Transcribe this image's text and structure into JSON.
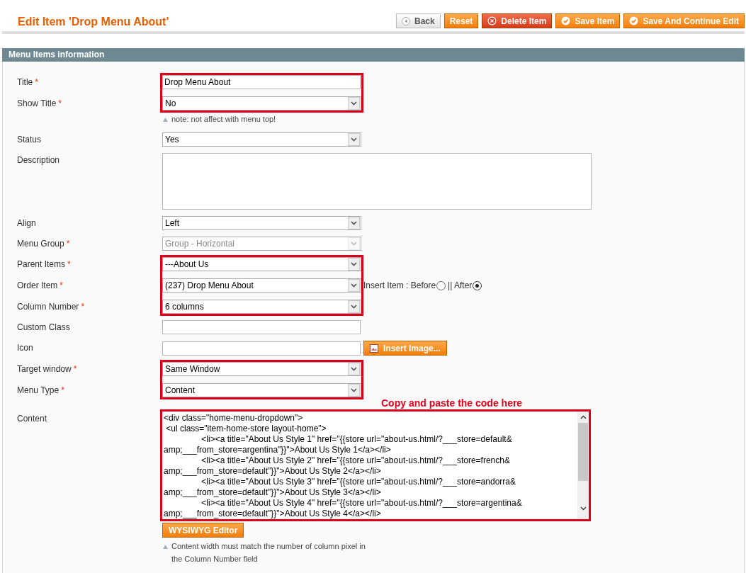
{
  "page_title": "Edit Item 'Drop Menu About'",
  "buttons": [
    {
      "label": "Back",
      "kind": "back"
    },
    {
      "label": "Reset",
      "kind": "plain"
    },
    {
      "label": "Delete Item",
      "kind": "delete"
    },
    {
      "label": "Save Item",
      "kind": "save"
    },
    {
      "label": "Save And Continue Edit",
      "kind": "save"
    }
  ],
  "section_title": "Menu Items information",
  "groups": [
    {
      "highlighted": true,
      "fields": [
        {
          "label": "Title",
          "mark": "*",
          "kind": "text",
          "value": "Drop Menu About"
        },
        {
          "label": "Show Title",
          "mark": "*",
          "kind": "select",
          "value": "No",
          "disabled": false
        }
      ],
      "note": "note: not affect with menu top!"
    },
    {
      "highlighted": false,
      "fields": [
        {
          "label": "Status",
          "kind": "select",
          "value": "Yes",
          "disabled": false
        }
      ]
    },
    {
      "highlighted": false,
      "fields": [
        {
          "label": "Description",
          "kind": "textarea"
        }
      ]
    },
    {
      "highlighted": false,
      "fields": [
        {
          "label": "Align",
          "kind": "select",
          "value": "Left",
          "disabled": false
        }
      ]
    },
    {
      "highlighted": false,
      "fields": [
        {
          "label": "Menu Group",
          "mark": "*",
          "kind": "select",
          "value": "Group - Horizontal",
          "disabled": true
        }
      ]
    },
    {
      "highlighted": true,
      "fields": [
        {
          "label": "Parent Items",
          "mark": "*",
          "kind": "select",
          "value": "---About Us",
          "disabled": false
        },
        {
          "label": "Order Item",
          "mark": "*",
          "kind": "select",
          "value": "(237) Drop Menu About",
          "disabled": false,
          "extra": {
            "label": "Insert Item :",
            "options": [
              {
                "label": "Before",
                "selected": false
              },
              {
                "label": "|| After",
                "selected": true
              }
            ]
          }
        },
        {
          "label": "Column Number",
          "mark": "*",
          "kind": "select",
          "value": "6 columns",
          "disabled": false
        }
      ]
    },
    {
      "highlighted": false,
      "fields": [
        {
          "label": "Custom Class",
          "kind": "text"
        }
      ]
    },
    {
      "highlighted": false,
      "fields": [
        {
          "label": "Icon",
          "kind": "image",
          "button": "Insert Image..."
        }
      ]
    },
    {
      "highlighted": true,
      "fields": [
        {
          "label": "Target window",
          "mark": "*",
          "kind": "select",
          "value": "Same Window",
          "disabled": false
        },
        {
          "label": "Menu Type",
          "mark": "*",
          "kind": "select",
          "value": "Content",
          "disabled": false
        }
      ]
    },
    {
      "highlighted": true,
      "annotation": "Copy and paste the code here",
      "fields": [
        {
          "label": "Content",
          "kind": "code",
          "lines": [
            "<div class=\"home-menu-dropdown\">",
            " <ul class=\"item-home-store layout-home\">",
            "\t\t<li><a title=\"About Us Style 1\" href=\"{{store url=\"about-us.html/?___store=default&",
            "amp;___from_store=argentina\"}}\">About Us Style 1</a></li>",
            "\t\t<li><a title=\"About Us Style 2\" href=\"{{store url=\"about-us.html/?___store=french&",
            "amp;___from_store=default\"}}\">About Us Style 2</a></li>",
            "\t\t<li><a title=\"About Us Style 3\" href=\"{{store url=\"about-us.html/?___store=andorra&",
            "amp;___from_store=default\"}}\">About Us Style 3</a></li>",
            "\t\t<li><a title=\"About Us Style 4\" href=\"{{store url=\"about-us.html/?___store=argentina&",
            "amp;___from_store=default\"}}\">About Us Style 4</a></li>"
          ]
        }
      ],
      "button": "WYSIWYG Editor",
      "note": "Content width must match the number of column pixel in the Column Number field"
    }
  ]
}
